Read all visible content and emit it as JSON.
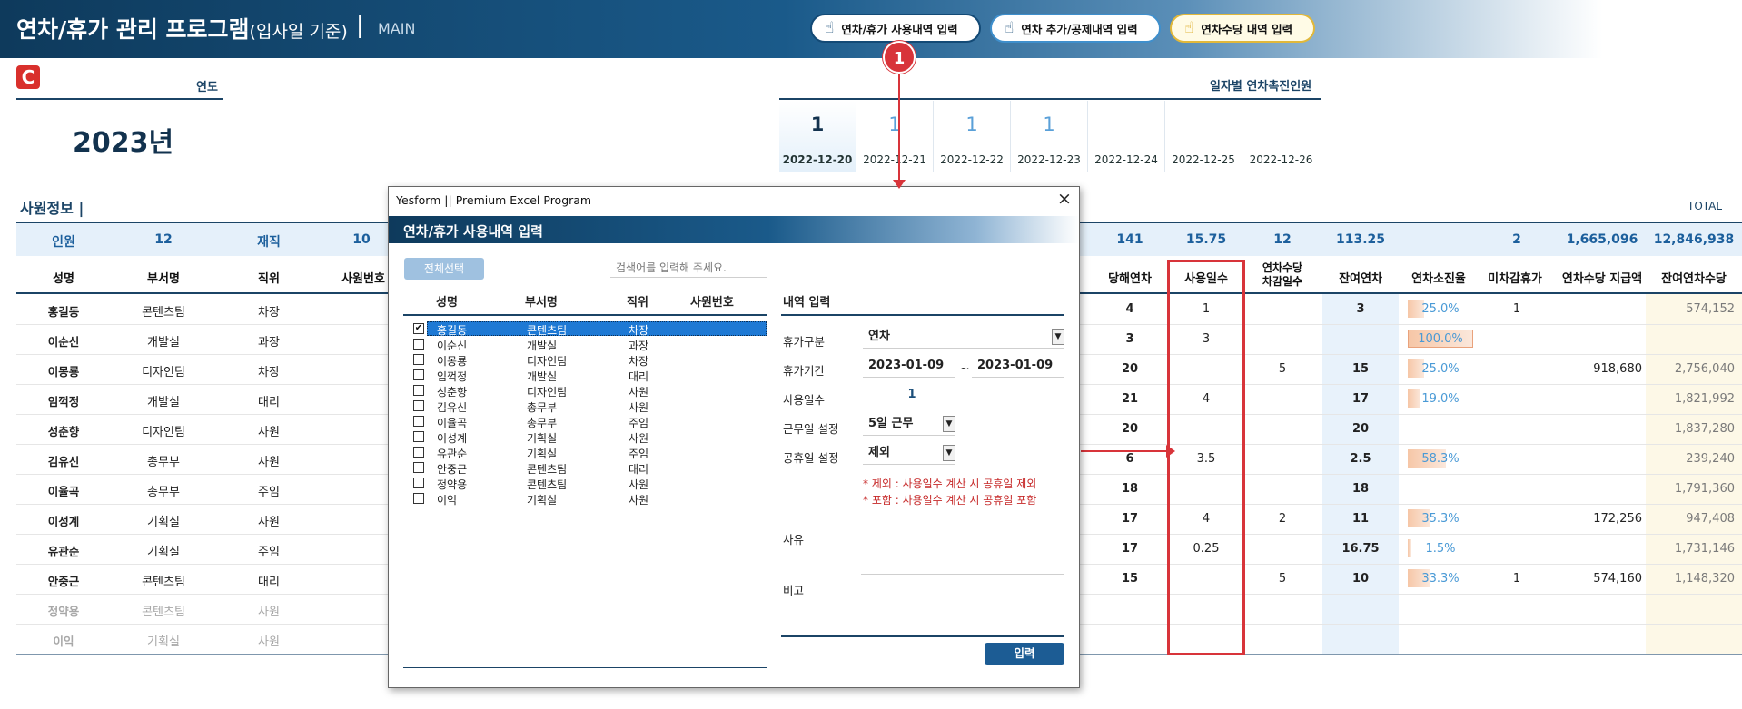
{
  "header": {
    "title": "연차/휴가 관리 프로그램",
    "subtitle": "(입사일 기준)",
    "separator": "|",
    "section": "MAIN",
    "buttons": {
      "use": "연차/휴가 사용내역 입력",
      "add": "연차 추가/공제내역 입력",
      "allowance": "연차수당 내역 입력"
    },
    "cursor_icon": "pointer-hand-icon"
  },
  "logo": {
    "letter": "C",
    "color": "#d9302c"
  },
  "year": {
    "label": "연도",
    "value": "2023년"
  },
  "promotion": {
    "title": "일자별 연차촉진인원",
    "days": [
      {
        "count": "1",
        "date": "2022-12-20"
      },
      {
        "count": "1",
        "date": "2022-12-21"
      },
      {
        "count": "1",
        "date": "2022-12-22"
      },
      {
        "count": "1",
        "date": "2022-12-23"
      },
      {
        "count": "",
        "date": "2022-12-24"
      },
      {
        "count": "",
        "date": "2022-12-25"
      },
      {
        "count": "",
        "date": "2022-12-26"
      }
    ]
  },
  "employees": {
    "title": "사원정보 |",
    "total_label": "TOTAL",
    "summary": {
      "headcount_label": "인원",
      "headcount": "12",
      "active_label": "재직",
      "active": "10",
      "current": "141",
      "used": "15.75",
      "allowance_days": "12",
      "remaining": "113.25",
      "unused_holiday": "2",
      "allowance_paid": "1,665,096",
      "remaining_allowance": "12,846,938"
    },
    "columns": {
      "name": "성명",
      "dept": "부서명",
      "position": "직위",
      "emp_no": "사원번호",
      "current": "당해연차",
      "used": "사용일수",
      "allowance_days_1": "연차수당",
      "allowance_days_2": "차감일수",
      "remaining": "잔여연차",
      "rate": "연차소진율",
      "unused": "미차감휴가",
      "paid": "연차수당 지급액",
      "remaining_allowance": "잔여연차수당"
    },
    "rows": [
      {
        "name": "홍길동",
        "dept": "콘텐츠팀",
        "position": "차장",
        "current": "4",
        "used": "1",
        "allowance_days": "",
        "remaining": "3",
        "rate": "25.0%",
        "rate_value": 25.0,
        "unused": "1",
        "paid": "",
        "remaining_allowance": "574,152"
      },
      {
        "name": "이순신",
        "dept": "개발실",
        "position": "과장",
        "current": "3",
        "used": "3",
        "allowance_days": "",
        "remaining": "",
        "rate": "100.0%",
        "rate_value": 100.0,
        "unused": "",
        "paid": "",
        "remaining_allowance": ""
      },
      {
        "name": "이몽룡",
        "dept": "디자인팀",
        "position": "차장",
        "current": "20",
        "used": "",
        "allowance_days": "5",
        "remaining": "15",
        "rate": "25.0%",
        "rate_value": 25.0,
        "unused": "",
        "paid": "918,680",
        "remaining_allowance": "2,756,040"
      },
      {
        "name": "임꺽정",
        "dept": "개발실",
        "position": "대리",
        "current": "21",
        "used": "4",
        "allowance_days": "",
        "remaining": "17",
        "rate": "19.0%",
        "rate_value": 19.0,
        "unused": "",
        "paid": "",
        "remaining_allowance": "1,821,992"
      },
      {
        "name": "성춘향",
        "dept": "디자인팀",
        "position": "사원",
        "current": "20",
        "used": "",
        "allowance_days": "",
        "remaining": "20",
        "rate": "",
        "rate_value": 0,
        "unused": "",
        "paid": "",
        "remaining_allowance": "1,837,280"
      },
      {
        "name": "김유신",
        "dept": "총무부",
        "position": "사원",
        "current": "6",
        "used": "3.5",
        "allowance_days": "",
        "remaining": "2.5",
        "rate": "58.3%",
        "rate_value": 58.3,
        "unused": "",
        "paid": "",
        "remaining_allowance": "239,240"
      },
      {
        "name": "이율곡",
        "dept": "총무부",
        "position": "주임",
        "current": "18",
        "used": "",
        "allowance_days": "",
        "remaining": "18",
        "rate": "",
        "rate_value": 0,
        "unused": "",
        "paid": "",
        "remaining_allowance": "1,791,360"
      },
      {
        "name": "이성계",
        "dept": "기획실",
        "position": "사원",
        "current": "17",
        "used": "4",
        "allowance_days": "2",
        "remaining": "11",
        "rate": "35.3%",
        "rate_value": 35.3,
        "unused": "",
        "paid": "172,256",
        "remaining_allowance": "947,408"
      },
      {
        "name": "유관순",
        "dept": "기획실",
        "position": "주임",
        "current": "17",
        "used": "0.25",
        "allowance_days": "",
        "remaining": "16.75",
        "rate": "1.5%",
        "rate_value": 1.5,
        "unused": "",
        "paid": "",
        "remaining_allowance": "1,731,146"
      },
      {
        "name": "안중근",
        "dept": "콘텐츠팀",
        "position": "대리",
        "current": "15",
        "used": "",
        "allowance_days": "5",
        "remaining": "10",
        "rate": "33.3%",
        "rate_value": 33.3,
        "unused": "1",
        "paid": "574,160",
        "remaining_allowance": "1,148,320"
      },
      {
        "name": "정약용",
        "dept": "콘텐츠팀",
        "position": "사원",
        "current": "",
        "used": "",
        "allowance_days": "",
        "remaining": "",
        "rate": "",
        "rate_value": 0,
        "unused": "",
        "paid": "",
        "remaining_allowance": "",
        "inactive": true
      },
      {
        "name": "이익",
        "dept": "기획실",
        "position": "사원",
        "current": "",
        "used": "",
        "allowance_days": "",
        "remaining": "",
        "rate": "",
        "rate_value": 0,
        "unused": "",
        "paid": "",
        "remaining_allowance": "",
        "inactive": true
      }
    ]
  },
  "callout": {
    "number": "1",
    "color": "#d8343a"
  },
  "dialog": {
    "caption": "Yesform  ||  Premium Excel Program",
    "close": "×",
    "title": "연차/휴가 사용내역 입력",
    "select_all": "전체선택",
    "search_placeholder": "검색어를 입력해 주세요.",
    "list_headers": {
      "name": "성명",
      "dept": "부서명",
      "position": "직위",
      "emp_no": "사원번호"
    },
    "list": [
      {
        "name": "홍길동",
        "dept": "콘텐츠팀",
        "position": "차장",
        "checked": true
      },
      {
        "name": "이순신",
        "dept": "개발실",
        "position": "과장",
        "checked": false
      },
      {
        "name": "이몽룡",
        "dept": "디자인팀",
        "position": "차장",
        "checked": false
      },
      {
        "name": "임꺽정",
        "dept": "개발실",
        "position": "대리",
        "checked": false
      },
      {
        "name": "성춘향",
        "dept": "디자인팀",
        "position": "사원",
        "checked": false
      },
      {
        "name": "김유신",
        "dept": "총무부",
        "position": "사원",
        "checked": false
      },
      {
        "name": "이율곡",
        "dept": "총무부",
        "position": "주임",
        "checked": false
      },
      {
        "name": "이성계",
        "dept": "기획실",
        "position": "사원",
        "checked": false
      },
      {
        "name": "유관순",
        "dept": "기획실",
        "position": "주임",
        "checked": false
      },
      {
        "name": "안중근",
        "dept": "콘텐츠팀",
        "position": "대리",
        "checked": false
      },
      {
        "name": "정약용",
        "dept": "콘텐츠팀",
        "position": "사원",
        "checked": false
      },
      {
        "name": "이익",
        "dept": "기획실",
        "position": "사원",
        "checked": false
      }
    ],
    "detail": {
      "title": "내역 입력",
      "leave_type_label": "휴가구분",
      "leave_type": "연차",
      "period_label": "휴가기간",
      "period_start": "2023-01-09",
      "period_sep": "~",
      "period_end": "2023-01-09",
      "days_label": "사용일수",
      "days": "1",
      "workday_label": "근무일 설정",
      "workday": "5일 근무",
      "holiday_label": "공휴일 설정",
      "holiday": "제외",
      "note_exclude": "* 제외 : 사용일수 계산 시 공휴일 제외",
      "note_include": "* 포함 : 사용일수 계산 시 공휴일 포함",
      "reason_label": "사유",
      "remark_label": "비고",
      "submit": "입력"
    }
  }
}
